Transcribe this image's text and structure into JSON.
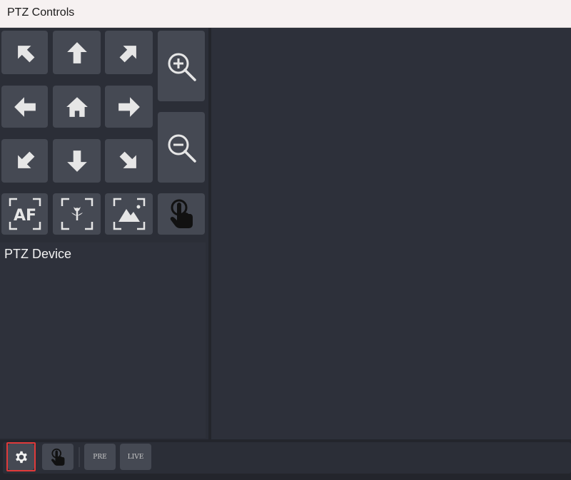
{
  "window": {
    "title": "PTZ Controls"
  },
  "ptz_grid": {
    "rows": [
      [
        "up-left-arrow",
        "up-arrow",
        "up-right-arrow",
        "zoom-in"
      ],
      [
        "left-arrow",
        "home",
        "right-arrow",
        "zoom-in"
      ],
      [
        "down-left-arrow",
        "down-arrow",
        "down-right-arrow",
        "zoom-out"
      ],
      [
        "autofocus",
        "macro-focus",
        "landscape-focus",
        "touch"
      ]
    ],
    "af_label": "AF"
  },
  "device_panel": {
    "label": "PTZ Device"
  },
  "bottom_toolbar": {
    "settings_icon": "gear-icon",
    "touch_icon": "hand-pointer-icon",
    "pre_label": "PRE",
    "live_label": "LIVE",
    "highlight_color": "#e03a3a"
  },
  "colors": {
    "button_bg": "#454953",
    "panel_bg": "#2b2e37",
    "icon_color": "#e6e6e6",
    "titlebar_bg": "#f6f1f1"
  }
}
